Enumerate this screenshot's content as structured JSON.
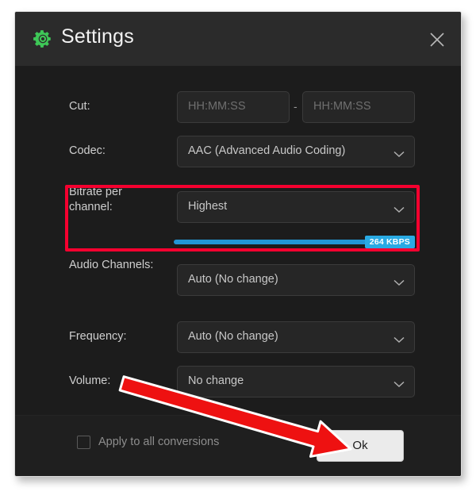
{
  "window": {
    "title": "Settings",
    "gear_icon": "gear-icon",
    "close_icon": "close-icon",
    "accent_green": "#3ec757",
    "background": "#1c1c1c",
    "header_background": "#2b2b2b"
  },
  "form": {
    "rows": [
      {
        "label": "Cut:",
        "type": "time-range",
        "start_placeholder": "HH:MM:SS",
        "start_value": "",
        "end_placeholder": "HH:MM:SS",
        "end_value": "",
        "separator": "-"
      },
      {
        "label": "Codec:",
        "type": "select",
        "value": "AAC (Advanced Audio Coding)"
      },
      {
        "label": "Bitrate per channel:",
        "type": "select-with-slider",
        "value": "Highest",
        "slider": {
          "badge": "264 KBPS",
          "value": 264,
          "fill_percent": 89,
          "track_color": "#2196d6",
          "badge_color": "#29aae3"
        },
        "highlighted": true
      },
      {
        "label": "Audio Channels:",
        "type": "select",
        "value": "Auto (No change)"
      },
      {
        "label": "Frequency:",
        "type": "select",
        "value": "Auto (No change)"
      },
      {
        "label": "Volume:",
        "type": "select",
        "value": "No change"
      }
    ]
  },
  "footer": {
    "checkbox_label": "Apply to all conversions",
    "checkbox_checked": false,
    "ok_label": "Ok"
  },
  "annotations": {
    "highlight_color": "#f5002f",
    "arrow_color": "#ee1111",
    "arrow_outline": "#ffffff",
    "highlight_target": "Bitrate per channel",
    "arrow_target": "Ok"
  }
}
